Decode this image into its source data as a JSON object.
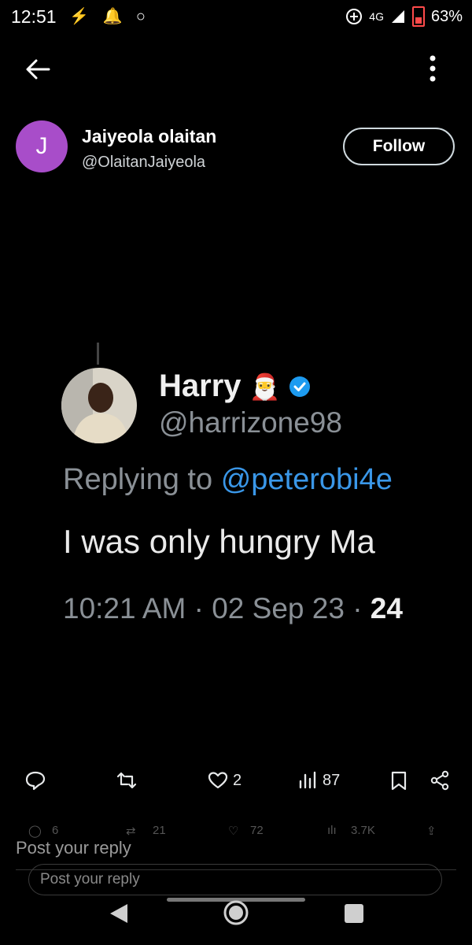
{
  "status": {
    "time": "12:51",
    "left_icons": "⚡ 🔔 ○",
    "network": "4G",
    "battery": "63%"
  },
  "author": {
    "avatar_letter": "J",
    "name": "Jaiyeola olaitan",
    "handle": "@OlaitanJaiyeola",
    "follow_label": "Follow"
  },
  "embedded": {
    "name": "Harry",
    "emoji": "🎅",
    "handle": "@harrizone98",
    "replying_prefix": "Replying to",
    "replying_mention": "@peterobi4e",
    "text": "I was only hungry Ma",
    "meta": "10:21 AM · 02 Sep 23 · ",
    "meta_bold": "24"
  },
  "actions": {
    "retweets": "",
    "likes": "2",
    "views": "87"
  },
  "ghost_actions": {
    "replies": "6",
    "retweets": "21",
    "likes": "72",
    "views": "3.7K"
  },
  "reply": {
    "label": "Post your reply",
    "placeholder": "Post your reply"
  },
  "colors": {
    "accent": "#1d9bf0",
    "avatar": "#a84dc9"
  }
}
